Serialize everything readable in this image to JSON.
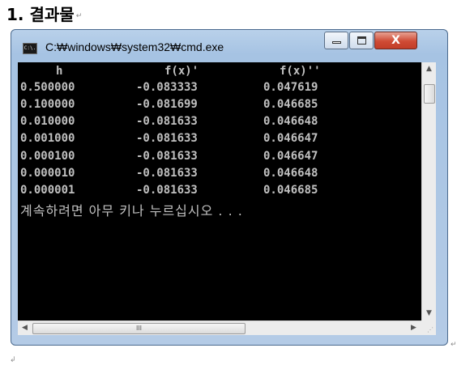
{
  "document": {
    "heading": "1. 결과물",
    "para_mark": "↵",
    "para_mark_small": "↲"
  },
  "window": {
    "title": "C:₩windows₩system32₩cmd.exe",
    "icon_label": "C:\\.",
    "icons": {
      "app": "cmd-icon",
      "minimize": "minimize-icon",
      "maximize": "maximize-icon",
      "close": "close-icon"
    },
    "close_glyph": "X",
    "close_color": "#c94531"
  },
  "console": {
    "background": "#000000",
    "text_color": "#c0c0c0",
    "headers": [
      "h",
      "f(x)'",
      "f(x)''"
    ],
    "rows": [
      [
        "0.500000",
        "-0.083333",
        "0.047619"
      ],
      [
        "0.100000",
        "-0.081699",
        "0.046685"
      ],
      [
        "0.010000",
        "-0.081633",
        "0.046648"
      ],
      [
        "0.001000",
        "-0.081633",
        "0.046647"
      ],
      [
        "0.000100",
        "-0.081633",
        "0.046647"
      ],
      [
        "0.000010",
        "-0.081633",
        "0.046648"
      ],
      [
        "0.000001",
        "-0.081633",
        "0.046685"
      ]
    ],
    "prompt": "계속하려면 아무 키나 누르십시오 . . ."
  },
  "scrollbars": {
    "up_arrow": "▲",
    "down_arrow": "▼",
    "left_arrow": "◀",
    "right_arrow": "▶",
    "thumb_grip": "III",
    "resize_grip": "⋰"
  }
}
